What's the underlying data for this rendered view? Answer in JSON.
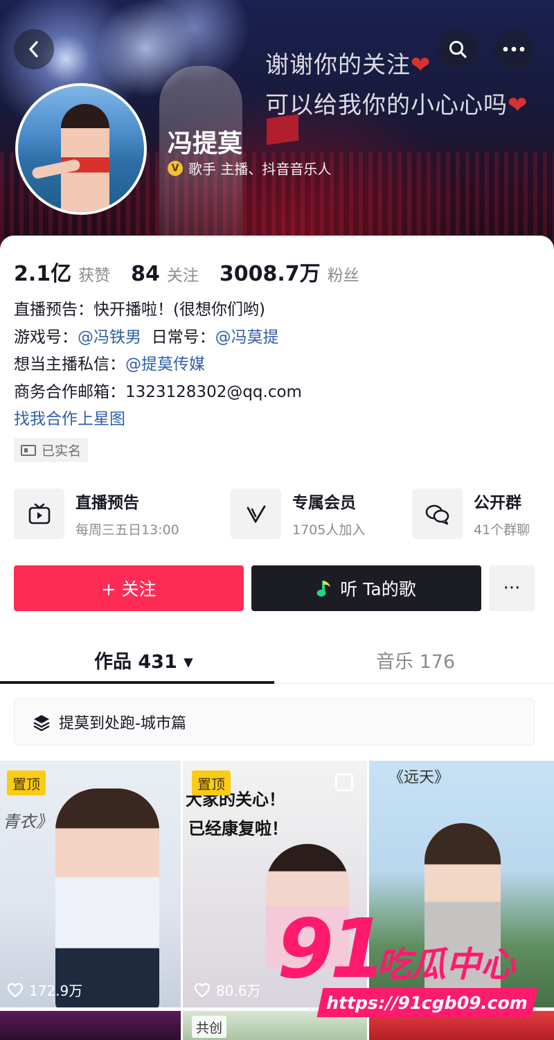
{
  "banner": {
    "line1": "谢谢你的关注",
    "line2": "可以给我你的小心心吗",
    "heart_glyph": "❤"
  },
  "profile": {
    "name": "冯提莫",
    "verify_badge": "V",
    "verify_text": "歌手  主播、抖音音乐人"
  },
  "stats": [
    {
      "value": "2.1亿",
      "label": "获赞"
    },
    {
      "value": "84",
      "label": "关注"
    },
    {
      "value": "3008.7万",
      "label": "粉丝"
    }
  ],
  "bio": {
    "line1": "直播预告：快开播啦！(很想你们哟)",
    "line2_prefix": "游戏号：",
    "line2_mention1": "@冯铁男",
    "line2_mid": "  日常号：",
    "line2_mention2": "@冯莫提",
    "line3_prefix": "想当主播私信：",
    "line3_mention": "@提莫传媒",
    "line4": "商务合作邮箱：1323128302@qq.com",
    "line5_link": "找我合作上星图"
  },
  "realname_tag": "已实名",
  "features": [
    {
      "title": "直播预告",
      "sub": "每周三五日13:00",
      "icon": "tv-icon"
    },
    {
      "title": "专属会员",
      "sub": "1705人加入",
      "icon": "v-member-icon"
    },
    {
      "title": "公开群",
      "sub": "41个群聊",
      "icon": "chat-bubbles-icon"
    }
  ],
  "actions": {
    "follow": "+ 关注",
    "listen": "听 Ta的歌",
    "more": "···"
  },
  "tabs": {
    "works": "作品 431 ▾",
    "music": "音乐 176"
  },
  "collection": {
    "title": "提莫到处跑-城市篇"
  },
  "videos": [
    {
      "pinned": "置顶",
      "likes": "172.9万",
      "caption": "青衣》"
    },
    {
      "pinned": "置顶",
      "likes": "80.6万",
      "caption1": "大家的关心！",
      "caption2": "已经康复啦！"
    },
    {
      "caption": "《远天》"
    }
  ],
  "row2": {
    "cocreate": "共创"
  },
  "watermark": {
    "number": "91",
    "text": "吃瓜中心",
    "url": "https://91cgb09.com"
  },
  "colors": {
    "follow": "#fe2c55",
    "music_button": "#1c1c24",
    "mention": "#2f5fa7",
    "pin": "#facc15",
    "watermark": "#ff1a6e"
  }
}
